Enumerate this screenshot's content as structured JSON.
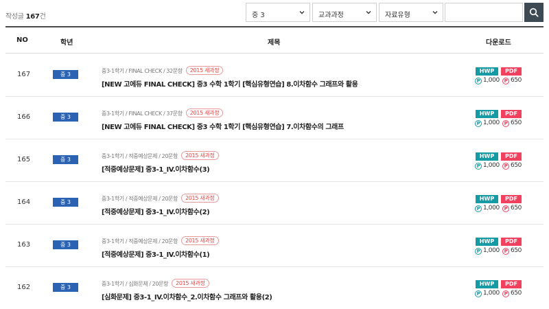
{
  "summary": {
    "prefix": "작성글 ",
    "count": "167",
    "suffix": "건"
  },
  "filters": {
    "grade": "중 3",
    "curriculum": "교과과정",
    "type": "자료유형",
    "search_placeholder": ""
  },
  "columns": {
    "no": "NO",
    "grade": "학년",
    "title": "제목",
    "download": "다운로드"
  },
  "download_labels": {
    "hwp": "HWP",
    "pdf": "PDF",
    "point_symbol": "P"
  },
  "rows": [
    {
      "no": "167",
      "grade": "중 3",
      "meta": "중3-1학기 / FINAL CHECK / 32문항",
      "tag": "2015 새과정",
      "title": "[NEW 고에듀 FINAL CHECK] 중3 수학 1학기 [핵심유형연습] 8.이차함수 그래프와 활용",
      "hwp_price": "1,000",
      "pdf_price": "650"
    },
    {
      "no": "166",
      "grade": "중 3",
      "meta": "중3-1학기 / FINAL CHECK / 37문항",
      "tag": "2015 새과정",
      "title": "[NEW 고에듀 FINAL CHECK] 중3 수학 1학기 [핵심유형연습] 7.이차함수의 그래프",
      "hwp_price": "1,000",
      "pdf_price": "650"
    },
    {
      "no": "165",
      "grade": "중 3",
      "meta": "중3-1학기 / 적중예상문제 / 20문항",
      "tag": "2015 새과정",
      "title": "[적중예상문제] 중3-1_IV.이차함수(3)",
      "hwp_price": "1,000",
      "pdf_price": "650"
    },
    {
      "no": "164",
      "grade": "중 3",
      "meta": "중3-1학기 / 적중예상문제 / 20문항",
      "tag": "2015 새과정",
      "title": "[적중예상문제] 중3-1_IV.이차함수(2)",
      "hwp_price": "1,000",
      "pdf_price": "650"
    },
    {
      "no": "163",
      "grade": "중 3",
      "meta": "중3-1학기 / 적중예상문제 / 20문항",
      "tag": "2015 새과정",
      "title": "[적중예상문제] 중3-1_IV.이차함수(1)",
      "hwp_price": "1,000",
      "pdf_price": "650"
    },
    {
      "no": "162",
      "grade": "중 3",
      "meta": "중3-1학기 / 심화문제 / 20문항",
      "tag": "2015 새과정",
      "title": "[심화문제] 중3-1_IV.이차함수_2.이차함수 그래프와 활용(2)",
      "hwp_price": "1,000",
      "pdf_price": "650"
    }
  ]
}
